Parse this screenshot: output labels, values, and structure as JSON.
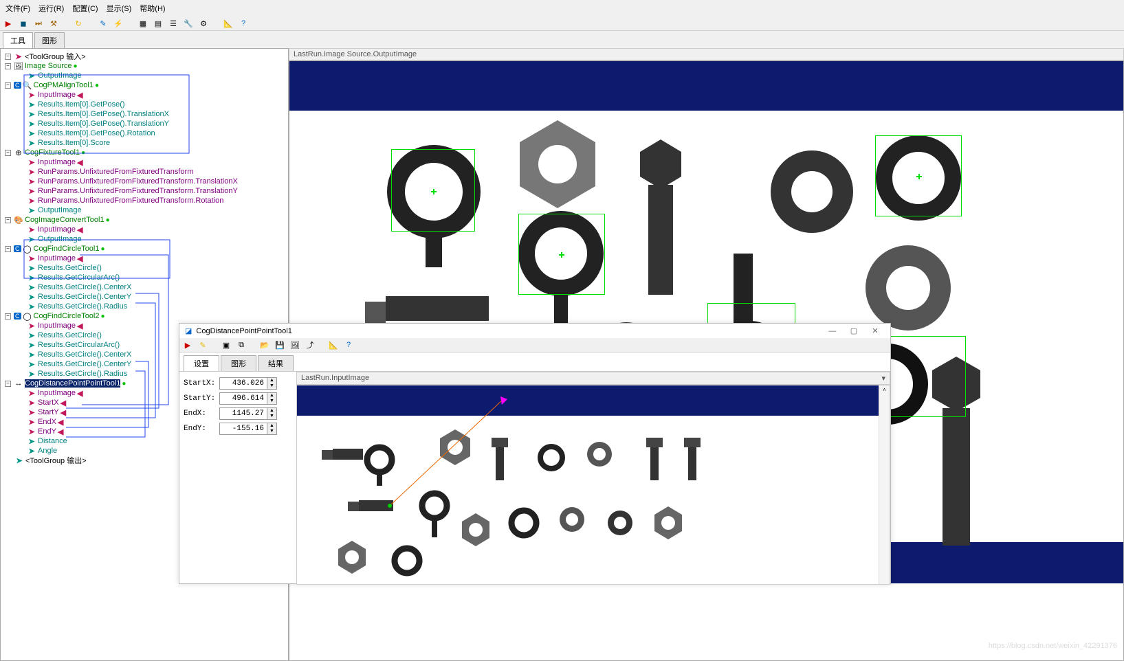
{
  "menu": {
    "file": "文件(F)",
    "run": "运行(R)",
    "config": "配置(C)",
    "show": "显示(S)",
    "help": "帮助(H)"
  },
  "tabs": {
    "tools": "工具",
    "shapes": "图形"
  },
  "tree": {
    "toolgroup_in": "<ToolGroup 输入>",
    "image_source": "Image Source",
    "output_image": "OutputImage",
    "pmalign": "CogPMAlignTool1",
    "input_image": "InputImage",
    "getpose": "Results.Item[0].GetPose()",
    "getpose_tx": "Results.Item[0].GetPose().TranslationX",
    "getpose_ty": "Results.Item[0].GetPose().TranslationY",
    "getpose_rot": "Results.Item[0].GetPose().Rotation",
    "score": "Results.Item[0].Score",
    "fixture": "CogFixtureTool1",
    "runparams": "RunParams.UnfixturedFromFixturedTransform",
    "runparams_tx": "RunParams.UnfixturedFromFixturedTransform.TranslationX",
    "runparams_ty": "RunParams.UnfixturedFromFixturedTransform.TranslationY",
    "runparams_rot": "RunParams.UnfixturedFromFixturedTransform.Rotation",
    "convert": "CogImageConvertTool1",
    "findcircle1": "CogFindCircleTool1",
    "getcircle": "Results.GetCircle()",
    "getcirculararc": "Results.GetCircularArc()",
    "getcircle_cx": "Results.GetCircle().CenterX",
    "getcircle_cy": "Results.GetCircle().CenterY",
    "getcircle_r": "Results.GetCircle().Radius",
    "findcircle2": "CogFindCircleTool2",
    "distance_tool": "CogDistancePointPointTool1",
    "startx": "StartX",
    "starty": "StartY",
    "endx": "EndX",
    "endy": "EndY",
    "distance": "Distance",
    "angle": "Angle",
    "toolgroup_out": "<ToolGroup 输出>"
  },
  "image_title": "LastRun.Image Source.OutputImage",
  "sub": {
    "title": "CogDistancePointPointTool1",
    "tabs": {
      "settings": "设置",
      "shapes": "图形",
      "results": "结果"
    },
    "params": {
      "startx_lbl": "StartX:",
      "startx_val": "436.026",
      "starty_lbl": "StartY:",
      "starty_val": "496.614",
      "endx_lbl": "EndX:",
      "endx_val": "1145.27",
      "endy_lbl": "EndY:",
      "endy_val": "-155.16"
    },
    "img_title": "LastRun.InputImage"
  },
  "watermark": "https://blog.csdn.net/weixin_42291376"
}
